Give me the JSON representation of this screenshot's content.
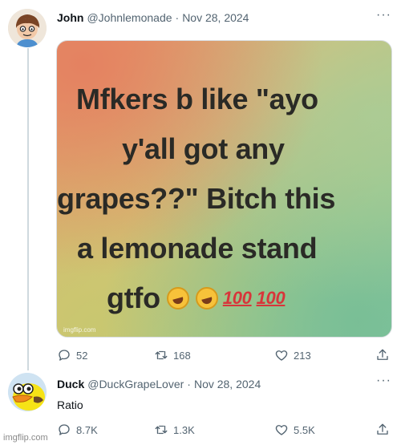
{
  "tweet": {
    "author_name": "John",
    "author_handle": "@Johnlemonade",
    "date": "Nov 28, 2024",
    "more": "···",
    "media": {
      "lines": [
        "Mfkers b like \"ayo",
        "y'all got any",
        "grapes??\" Bitch this",
        "a lemonade stand",
        "gtfo"
      ],
      "emoji_100": "100",
      "watermark": "imgflip.com"
    },
    "stats": {
      "replies": "52",
      "retweets": "168",
      "likes": "213"
    }
  },
  "reply": {
    "author_name": "Duck",
    "author_handle": "@DuckGrapeLover",
    "date": "Nov 28, 2024",
    "more": "···",
    "text": "Ratio",
    "stats": {
      "replies": "8.7K",
      "retweets": "1.3K",
      "likes": "5.5K"
    }
  },
  "watermark": "imgflip.com",
  "icons": [
    "reply-icon",
    "retweet-icon",
    "like-icon",
    "share-icon",
    "more-icon"
  ],
  "colors": {
    "text": "#0f1419",
    "muted": "#536471",
    "thread_line": "#cfd9de"
  }
}
